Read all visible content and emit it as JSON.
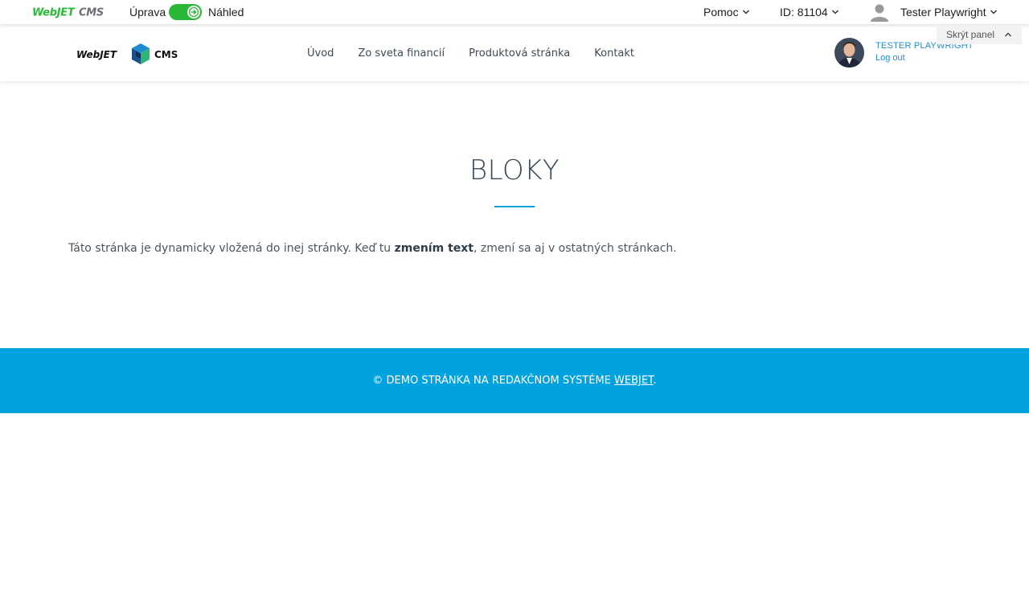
{
  "admin_bar": {
    "logo_text": "WebJETCMS",
    "edit_label": "Úprava",
    "preview_label": "Náhled",
    "help_label": "Pomoc",
    "id_label": "ID: 81104",
    "user_label": "Tester Playwright",
    "hide_panel_label": "Skrýt panel",
    "accent_color": "#2ab936"
  },
  "site_header": {
    "logo_text_left": "WebJET",
    "logo_text_right": "CMS",
    "nav": [
      {
        "label": "Úvod"
      },
      {
        "label": "Zo sveta financií"
      },
      {
        "label": "Produktová stránka"
      },
      {
        "label": "Kontakt"
      }
    ],
    "profile_name": "TESTER PLAYWRIGHT",
    "logout_label": "Log out",
    "link_color": "#1a8fd8"
  },
  "main": {
    "title": "BLOKY",
    "text_before": "Táto stránka je dynamicky vložená do inej stránky. Keď tu ",
    "text_bold": "zmením text",
    "text_after": ", zmení sa aj v ostatných stránkach."
  },
  "footer": {
    "text": "© DEMO STRÁNKA NA REDAKČNOM SYSTÉME ",
    "link_text": "WEBJET",
    "suffix": ".",
    "background": "#00a3e0"
  }
}
